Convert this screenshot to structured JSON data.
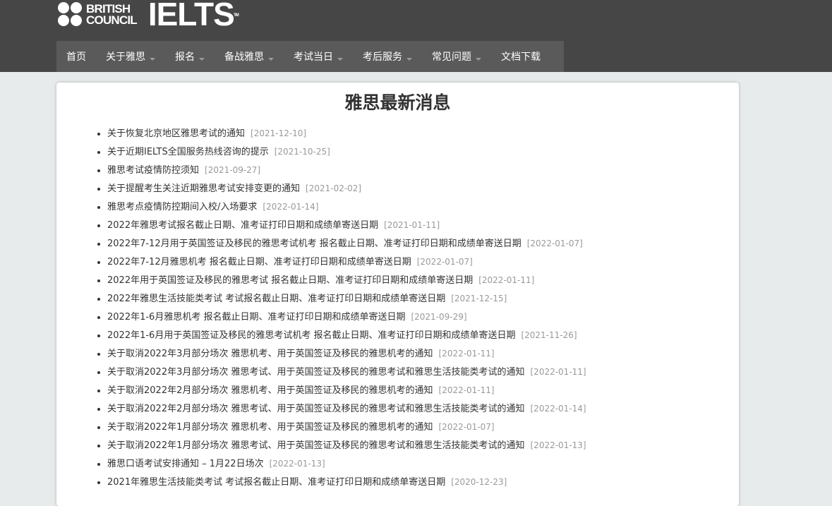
{
  "brand": {
    "line1": "BRITISH",
    "line2": "COUNCIL",
    "product": "IELTS",
    "tm": "TM"
  },
  "nav": [
    {
      "label": "首页",
      "dropdown": false
    },
    {
      "label": "关于雅思",
      "dropdown": true
    },
    {
      "label": "报名",
      "dropdown": true
    },
    {
      "label": "备战雅思",
      "dropdown": true
    },
    {
      "label": "考试当日",
      "dropdown": true
    },
    {
      "label": "考后服务",
      "dropdown": true
    },
    {
      "label": "常见问题",
      "dropdown": true
    },
    {
      "label": "文档下载",
      "dropdown": false
    }
  ],
  "page_title": "雅思最新消息",
  "news": [
    {
      "title": "关于恢复北京地区雅思考试的通知",
      "date": "[2021-12-10]"
    },
    {
      "title": "关于近期IELTS全国服务热线咨询的提示",
      "date": "[2021-10-25]"
    },
    {
      "title": "雅思考试疫情防控须知",
      "date": "[2021-09-27]"
    },
    {
      "title": "关于提醒考生关注近期雅思考试安排变更的通知",
      "date": "[2021-02-02]"
    },
    {
      "title": "雅思考点疫情防控期间入校/入场要求",
      "date": "[2022-01-14]"
    },
    {
      "title": "2022年雅思考试报名截止日期、准考证打印日期和成绩单寄送日期",
      "date": "[2021-01-11]"
    },
    {
      "title": "2022年7-12月用于英国签证及移民的雅思考试机考 报名截止日期、准考证打印日期和成绩单寄送日期",
      "date": "[2022-01-07]"
    },
    {
      "title": "2022年7-12月雅思机考 报名截止日期、准考证打印日期和成绩单寄送日期",
      "date": "[2022-01-07]"
    },
    {
      "title": "2022年用于英国签证及移民的雅思考试 报名截止日期、准考证打印日期和成绩单寄送日期",
      "date": "[2022-01-11]"
    },
    {
      "title": "2022年雅思生活技能类考试 考试报名截止日期、准考证打印日期和成绩单寄送日期",
      "date": "[2021-12-15]"
    },
    {
      "title": "2022年1-6月雅思机考 报名截止日期、准考证打印日期和成绩单寄送日期",
      "date": "[2021-09-29]"
    },
    {
      "title": "2022年1-6月用于英国签证及移民的雅思考试机考 报名截止日期、准考证打印日期和成绩单寄送日期",
      "date": "[2021-11-26]"
    },
    {
      "title": "关于取消2022年3月部分场次 雅思机考、用于英国签证及移民的雅思机考的通知",
      "date": "[2022-01-11]"
    },
    {
      "title": "关于取消2022年3月部分场次 雅思考试、用于英国签证及移民的雅思考试和雅思生活技能类考试的通知",
      "date": "[2022-01-11]"
    },
    {
      "title": "关于取消2022年2月部分场次 雅思机考、用于英国签证及移民的雅思机考的通知",
      "date": "[2022-01-11]"
    },
    {
      "title": "关于取消2022年2月部分场次 雅思考试、用于英国签证及移民的雅思考试和雅思生活技能类考试的通知",
      "date": "[2022-01-14]"
    },
    {
      "title": "关于取消2022年1月部分场次 雅思机考、用于英国签证及移民的雅思机考的通知",
      "date": "[2022-01-07]"
    },
    {
      "title": "关于取消2022年1月部分场次 雅思考试、用于英国签证及移民的雅思考试和雅思生活技能类考试的通知",
      "date": "[2022-01-13]"
    },
    {
      "title": "雅思口语考试安排通知 – 1月22日场次",
      "date": "[2022-01-13]"
    },
    {
      "title": "2021年雅思生活技能类考试 考试报名截止日期、准考证打印日期和成绩单寄送日期",
      "date": "[2020-12-23]"
    }
  ]
}
